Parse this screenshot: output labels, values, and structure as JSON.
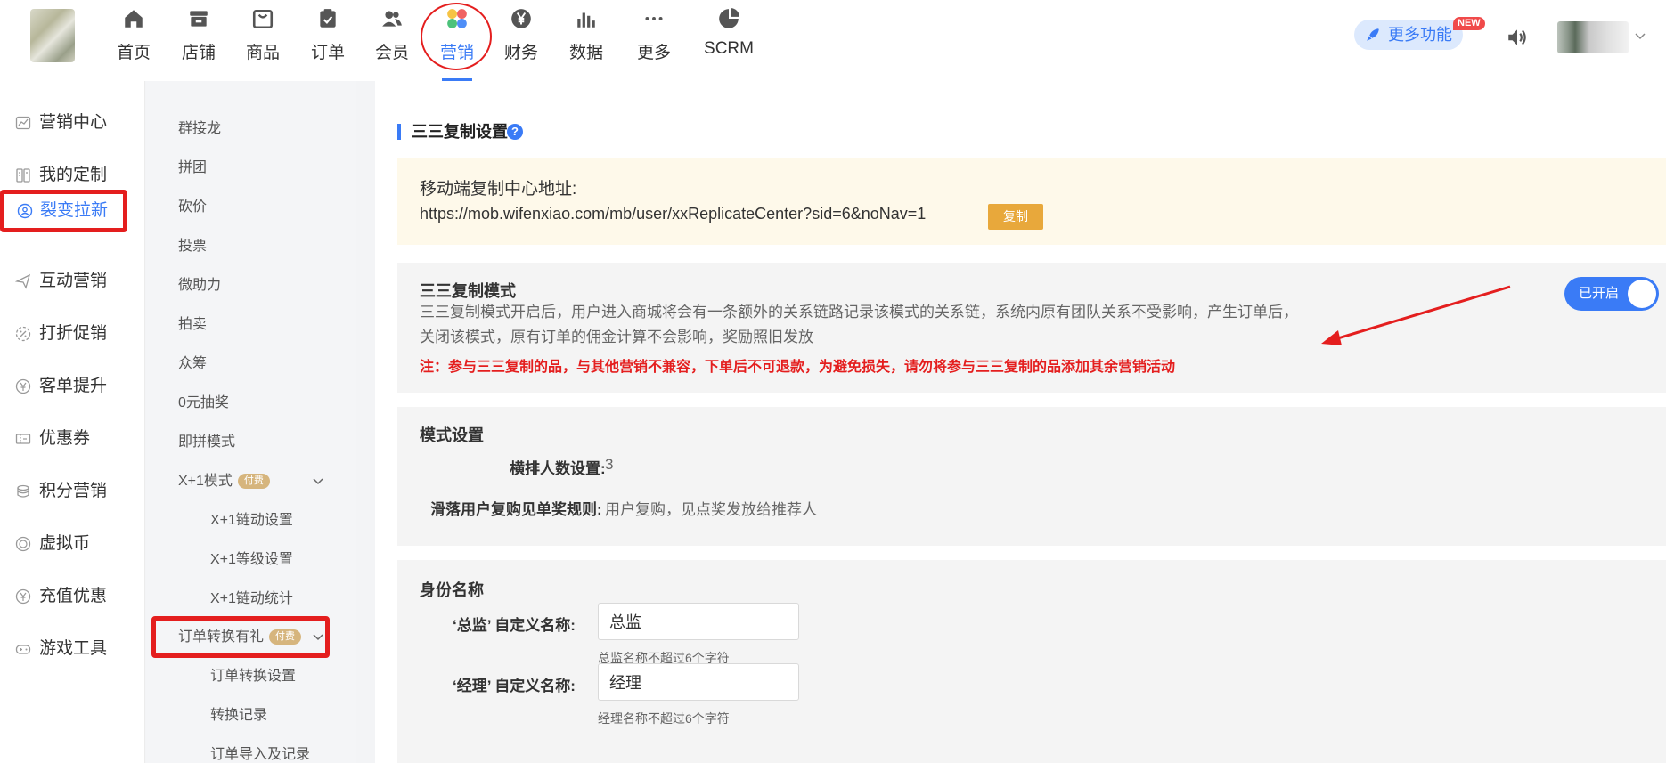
{
  "nav": {
    "items": [
      {
        "label": "首页",
        "icon": "home-icon"
      },
      {
        "label": "店铺",
        "icon": "store-icon"
      },
      {
        "label": "商品",
        "icon": "goods-icon"
      },
      {
        "label": "订单",
        "icon": "order-icon"
      },
      {
        "label": "会员",
        "icon": "members-icon"
      },
      {
        "label": "营销",
        "icon": "marketing-icon"
      },
      {
        "label": "财务",
        "icon": "yen-icon"
      },
      {
        "label": "数据",
        "icon": "bar-chart-icon"
      },
      {
        "label": "更多",
        "icon": "more-icon"
      },
      {
        "label": "SCRM",
        "icon": "pie-chart-icon"
      }
    ],
    "active": "营销",
    "more_features": "更多功能",
    "new_badge": "NEW",
    "accent": "#3a7bf6",
    "highlight": "#e41e1e"
  },
  "sidebar": {
    "items": [
      {
        "label": "营销中心",
        "icon": "trend-icon"
      },
      {
        "label": "我的定制",
        "icon": "custom-icon"
      },
      {
        "label": "裂变拉新",
        "icon": "user-refresh-icon"
      },
      {
        "label": "互动营销",
        "icon": "send-icon"
      },
      {
        "label": "打折促销",
        "icon": "discount-icon"
      },
      {
        "label": "客单提升",
        "icon": "yen-circle-icon"
      },
      {
        "label": "优惠券",
        "icon": "coupon-icon"
      },
      {
        "label": "积分营销",
        "icon": "coins-icon"
      },
      {
        "label": "虚拟币",
        "icon": "coin-icon"
      },
      {
        "label": "充值优惠",
        "icon": "recharge-icon"
      },
      {
        "label": "游戏工具",
        "icon": "gamepad-icon"
      }
    ],
    "active": "裂变拉新"
  },
  "submenu": {
    "items": [
      "群接龙",
      "拼团",
      "砍价",
      "投票",
      "微助力",
      "拍卖",
      "众筹",
      "0元抽奖",
      "即拼模式",
      "X+1模式",
      "X+1链动设置",
      "X+1等级设置",
      "X+1链动统计",
      "订单转换有礼",
      "订单转换设置",
      "转换记录",
      "订单导入及记录"
    ],
    "paid_badge": "付费"
  },
  "main": {
    "section_title": "三三复制设置",
    "help": "?",
    "notice": {
      "title": "移动端复制中心地址:",
      "url": "https://mob.wifenxiao.com/mb/user/xxReplicateCenter?sid=6&noNav=1",
      "copy_button": "复制"
    },
    "mode": {
      "title": "三三复制模式",
      "desc": "三三复制模式开启后，用户进入商城将会有一条额外的关系链路记录该模式的关系链，系统内原有团队关系不受影响，产生订单后，关闭该模式，原有订单的佣金计算不会影响，奖励照旧发放",
      "note": "注：参与三三复制的品，与其他营销不兼容，下单后不可退款，为避免损失，请勿将参与三三复制的品添加其余营销活动",
      "toggle_label": "已开启",
      "enabled": true
    },
    "mode_settings": {
      "title": "模式设置",
      "rows": [
        {
          "label": "横排人数设置:",
          "value": "3"
        },
        {
          "label": "滑落用户复购见单奖规则:",
          "value": "用户复购，见点奖发放给推荐人"
        }
      ]
    },
    "identity": {
      "title": "身份名称",
      "fields": [
        {
          "label": "‘总监’ 自定义名称:",
          "value": "总监",
          "hint": "总监名称不超过6个字符"
        },
        {
          "label": "‘经理’ 自定义名称:",
          "value": "经理",
          "hint": "经理名称不超过6个字符"
        }
      ]
    }
  }
}
